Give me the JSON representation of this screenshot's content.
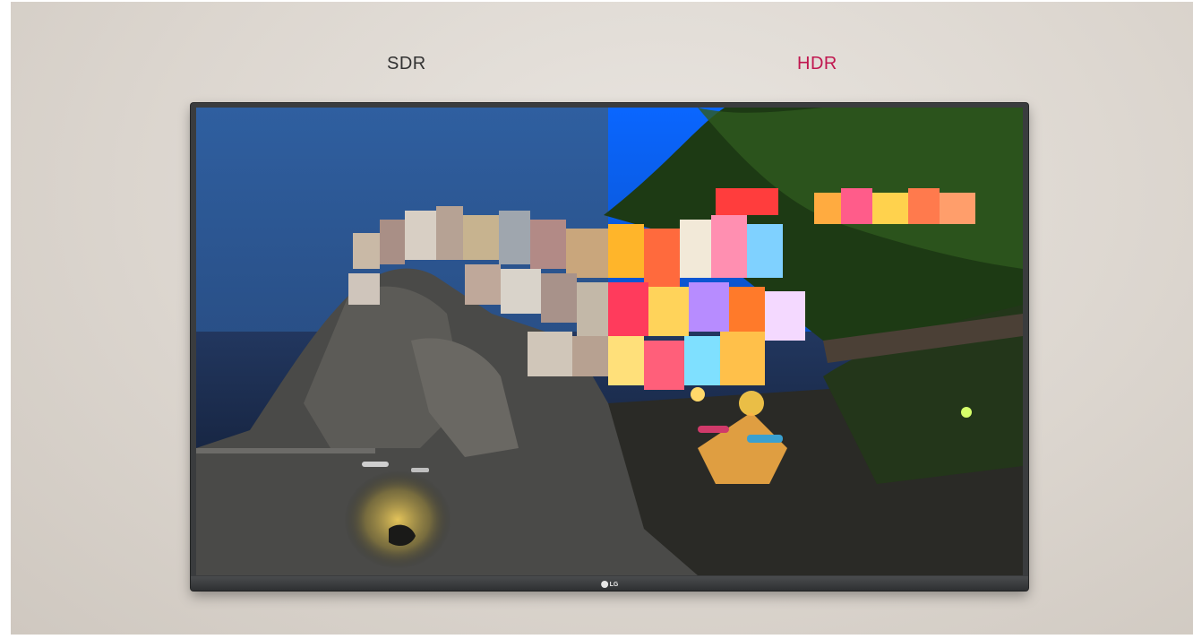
{
  "labels": {
    "sdr": "SDR",
    "hdr": "HDR"
  },
  "tv": {
    "brand": "LG"
  },
  "colors": {
    "hdr_label": "#c0174f",
    "sdr_label": "#333333",
    "sdr_sky": "#2b5c9a",
    "hdr_sky": "#1570e6"
  }
}
